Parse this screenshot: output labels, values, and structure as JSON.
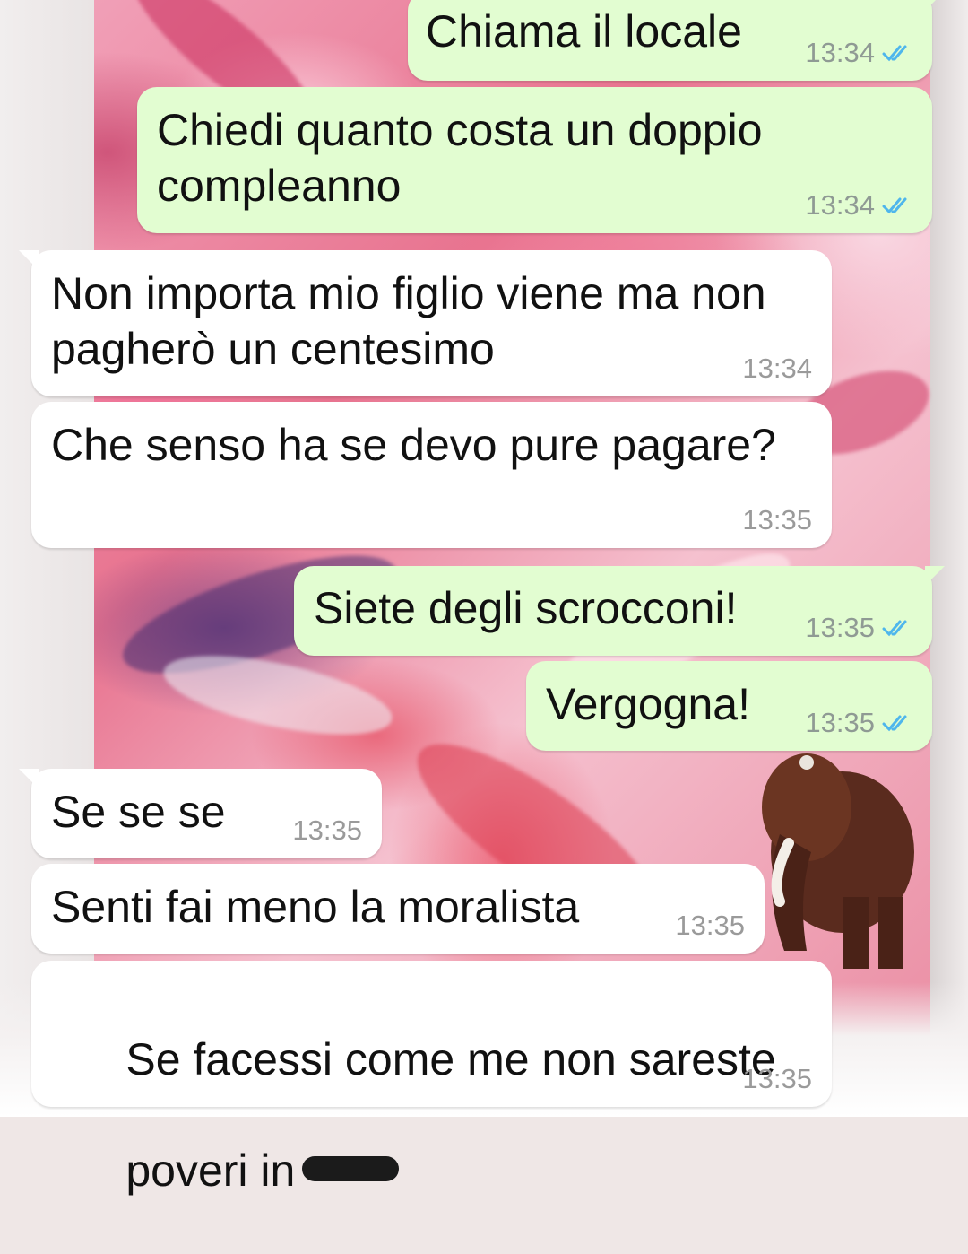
{
  "colors": {
    "outgoing_bubble": "#e2fdd1",
    "incoming_bubble": "#ffffff",
    "read_ticks": "#4fb6ec",
    "timestamp": "#8f9a94"
  },
  "messages": [
    {
      "direction": "outgoing",
      "text": "Chiama il locale",
      "time": "13:34",
      "status_icon": "double-check-read-icon"
    },
    {
      "direction": "outgoing",
      "text": "Chiedi quanto costa un doppio\ncompleanno",
      "time": "13:34",
      "status_icon": "double-check-read-icon"
    },
    {
      "direction": "incoming",
      "text": "Non importa mio figlio viene ma non\npagherò un centesimo",
      "time": "13:34"
    },
    {
      "direction": "incoming",
      "text": "Che senso ha se devo pure pagare?",
      "time": "13:35"
    },
    {
      "direction": "outgoing",
      "text": "Siete degli scrocconi!",
      "time": "13:35",
      "status_icon": "double-check-read-icon"
    },
    {
      "direction": "outgoing",
      "text": "Vergogna!",
      "time": "13:35",
      "status_icon": "double-check-read-icon"
    },
    {
      "direction": "incoming",
      "text": "Se se se",
      "time": "13:35"
    },
    {
      "direction": "incoming",
      "text": "Senti fai meno la moralista",
      "time": "13:35"
    },
    {
      "direction": "incoming",
      "text_line1": "Se facessi come me non sareste",
      "text_line2": "poveri in",
      "redacted_word": true,
      "time": "13:35"
    }
  ]
}
